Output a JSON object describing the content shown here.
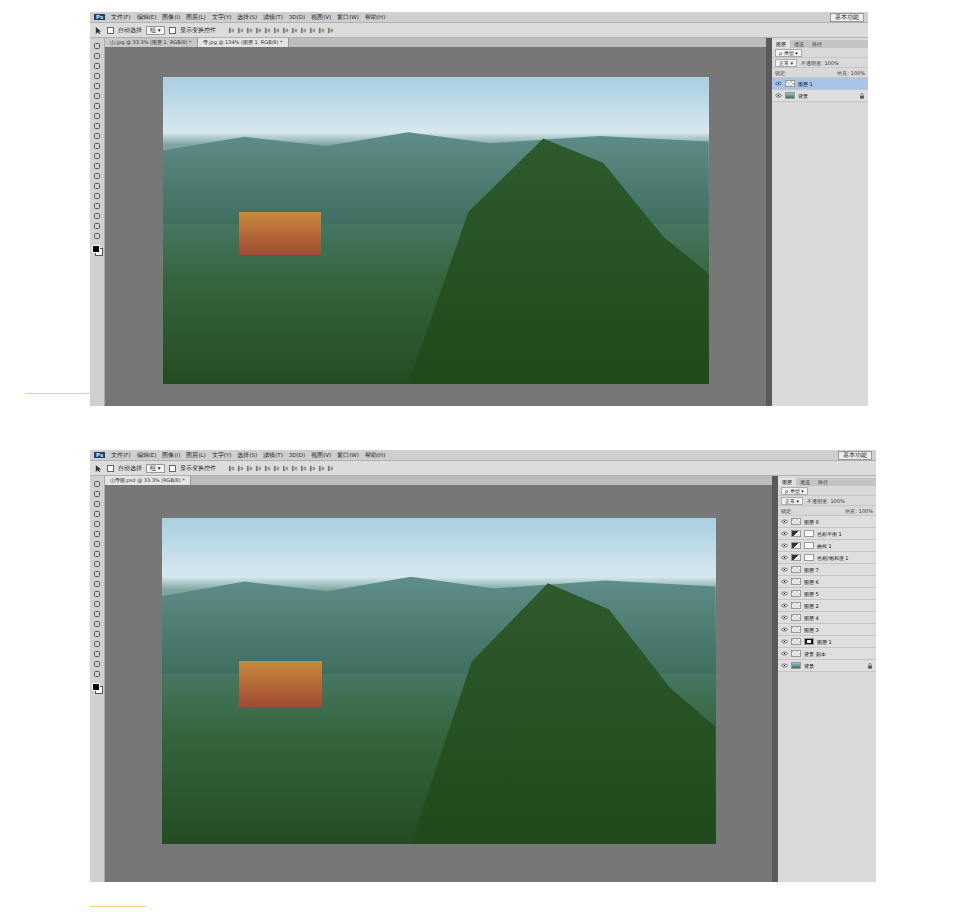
{
  "screenshots": [
    {
      "logo": "Ps",
      "menu": [
        "文件(F)",
        "编辑(E)",
        "图像(I)",
        "图层(L)",
        "文字(Y)",
        "选择(S)",
        "滤镜(T)",
        "3D(D)",
        "视图(V)",
        "窗口(W)",
        "帮助(H)"
      ],
      "options": {
        "auto_select": "自动选择",
        "auto_select_checked": false,
        "group": "组",
        "show_transform": "显示变换控件",
        "show_transform_checked": false
      },
      "tabs": [
        {
          "label": "山.jpg @ 33.3% (图层 1, RGB/8) *",
          "selected": false
        },
        {
          "label": "寺.jpg @ 134% (图层 1, RGB/8) *",
          "selected": true
        }
      ],
      "workspace": "基本功能",
      "panel_tabs": [
        {
          "label": "图层",
          "selected": true
        },
        {
          "label": "通道",
          "selected": false
        },
        {
          "label": "路径",
          "selected": false
        }
      ],
      "filter": "ρ 类型",
      "blend_mode": "正常",
      "opacity": "不透明度: 100%",
      "lock": "锁定:",
      "fill": "填充: 100%",
      "layers": [
        {
          "name": "图层 1",
          "kind": "pixel",
          "visible": true,
          "selected": true,
          "locked": false
        },
        {
          "name": "背景",
          "kind": "background",
          "visible": true,
          "selected": false,
          "locked": true
        }
      ]
    },
    {
      "logo": "Ps",
      "menu": [
        "文件(F)",
        "编辑(E)",
        "图像(I)",
        "图层(L)",
        "文字(Y)",
        "选择(S)",
        "滤镜(T)",
        "3D(D)",
        "视图(V)",
        "窗口(W)",
        "帮助(H)"
      ],
      "options": {
        "auto_select": "自动选择",
        "auto_select_checked": false,
        "group": "组",
        "show_transform": "显示变换控件",
        "show_transform_checked": false
      },
      "tabs": [
        {
          "label": "山寺图.psd @ 33.3% (RGB/8) *",
          "selected": true
        }
      ],
      "workspace": "基本功能",
      "panel_tabs": [
        {
          "label": "图层",
          "selected": true
        },
        {
          "label": "通道",
          "selected": false
        },
        {
          "label": "路径",
          "selected": false
        }
      ],
      "filter": "ρ 类型",
      "blend_mode": "正常",
      "opacity": "不透明度: 100%",
      "lock": "锁定:",
      "fill": "填充: 100%",
      "layers": [
        {
          "name": "图层 8",
          "kind": "pixel",
          "visible": true,
          "selected": false,
          "locked": false
        },
        {
          "name": "色彩平衡 1",
          "kind": "adjustment",
          "visible": true,
          "selected": false,
          "locked": false
        },
        {
          "name": "曲线 1",
          "kind": "adjustment",
          "visible": true,
          "selected": false,
          "locked": false
        },
        {
          "name": "色相/饱和度 1",
          "kind": "adjustment",
          "visible": true,
          "selected": false,
          "locked": false
        },
        {
          "name": "图层 7",
          "kind": "pixel",
          "visible": true,
          "selected": false,
          "locked": false
        },
        {
          "name": "图层 6",
          "kind": "pixel",
          "visible": true,
          "selected": false,
          "locked": false
        },
        {
          "name": "图层 5",
          "kind": "pixel",
          "visible": true,
          "selected": false,
          "locked": false
        },
        {
          "name": "图层 2",
          "kind": "pixel",
          "visible": true,
          "selected": false,
          "locked": false
        },
        {
          "name": "图层 4",
          "kind": "pixel",
          "visible": true,
          "selected": false,
          "locked": false
        },
        {
          "name": "图层 3",
          "kind": "pixel",
          "visible": true,
          "selected": false,
          "locked": false
        },
        {
          "name": "图层 1",
          "kind": "masked",
          "visible": true,
          "selected": false,
          "locked": false
        },
        {
          "name": "背景 副本",
          "kind": "pixel",
          "visible": true,
          "selected": false,
          "locked": false
        },
        {
          "name": "背景",
          "kind": "background",
          "visible": true,
          "selected": false,
          "locked": true
        }
      ]
    }
  ]
}
